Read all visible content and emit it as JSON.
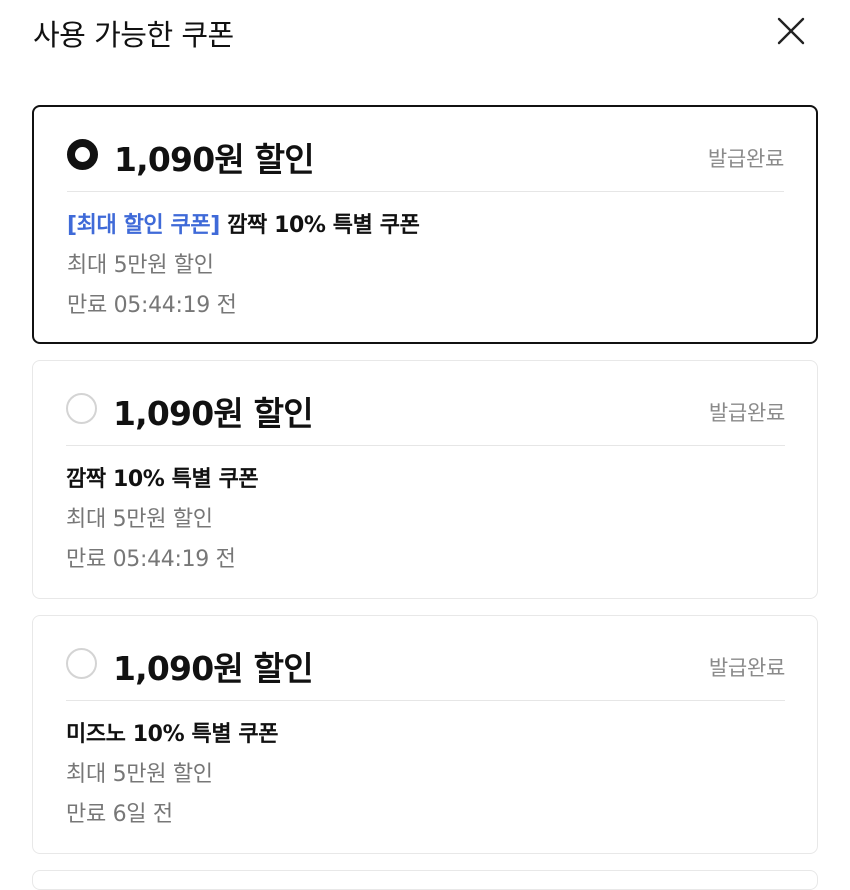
{
  "header": {
    "title": "사용 가능한 쿠폰"
  },
  "coupons": [
    {
      "selected": true,
      "amount": "1,090원 할인",
      "status": "발급완료",
      "tag": "[최대 할인 쿠폰]",
      "name": " 깜짝 10% 특별 쿠폰",
      "max_discount": "최대 5만원 할인",
      "expiry": "만료 05:44:19 전"
    },
    {
      "selected": false,
      "amount": "1,090원 할인",
      "status": "발급완료",
      "tag": "",
      "name": "깜짝 10% 특별 쿠폰",
      "max_discount": "최대 5만원 할인",
      "expiry": "만료 05:44:19 전"
    },
    {
      "selected": false,
      "amount": "1,090원 할인",
      "status": "발급완료",
      "tag": "",
      "name": "미즈노 10% 특별 쿠폰",
      "max_discount": "최대 5만원 할인",
      "expiry": "만료 6일 전"
    }
  ],
  "colors": {
    "tag_blue": "#3f6ad8",
    "selected_border": "#111111",
    "muted_text": "#777777"
  }
}
